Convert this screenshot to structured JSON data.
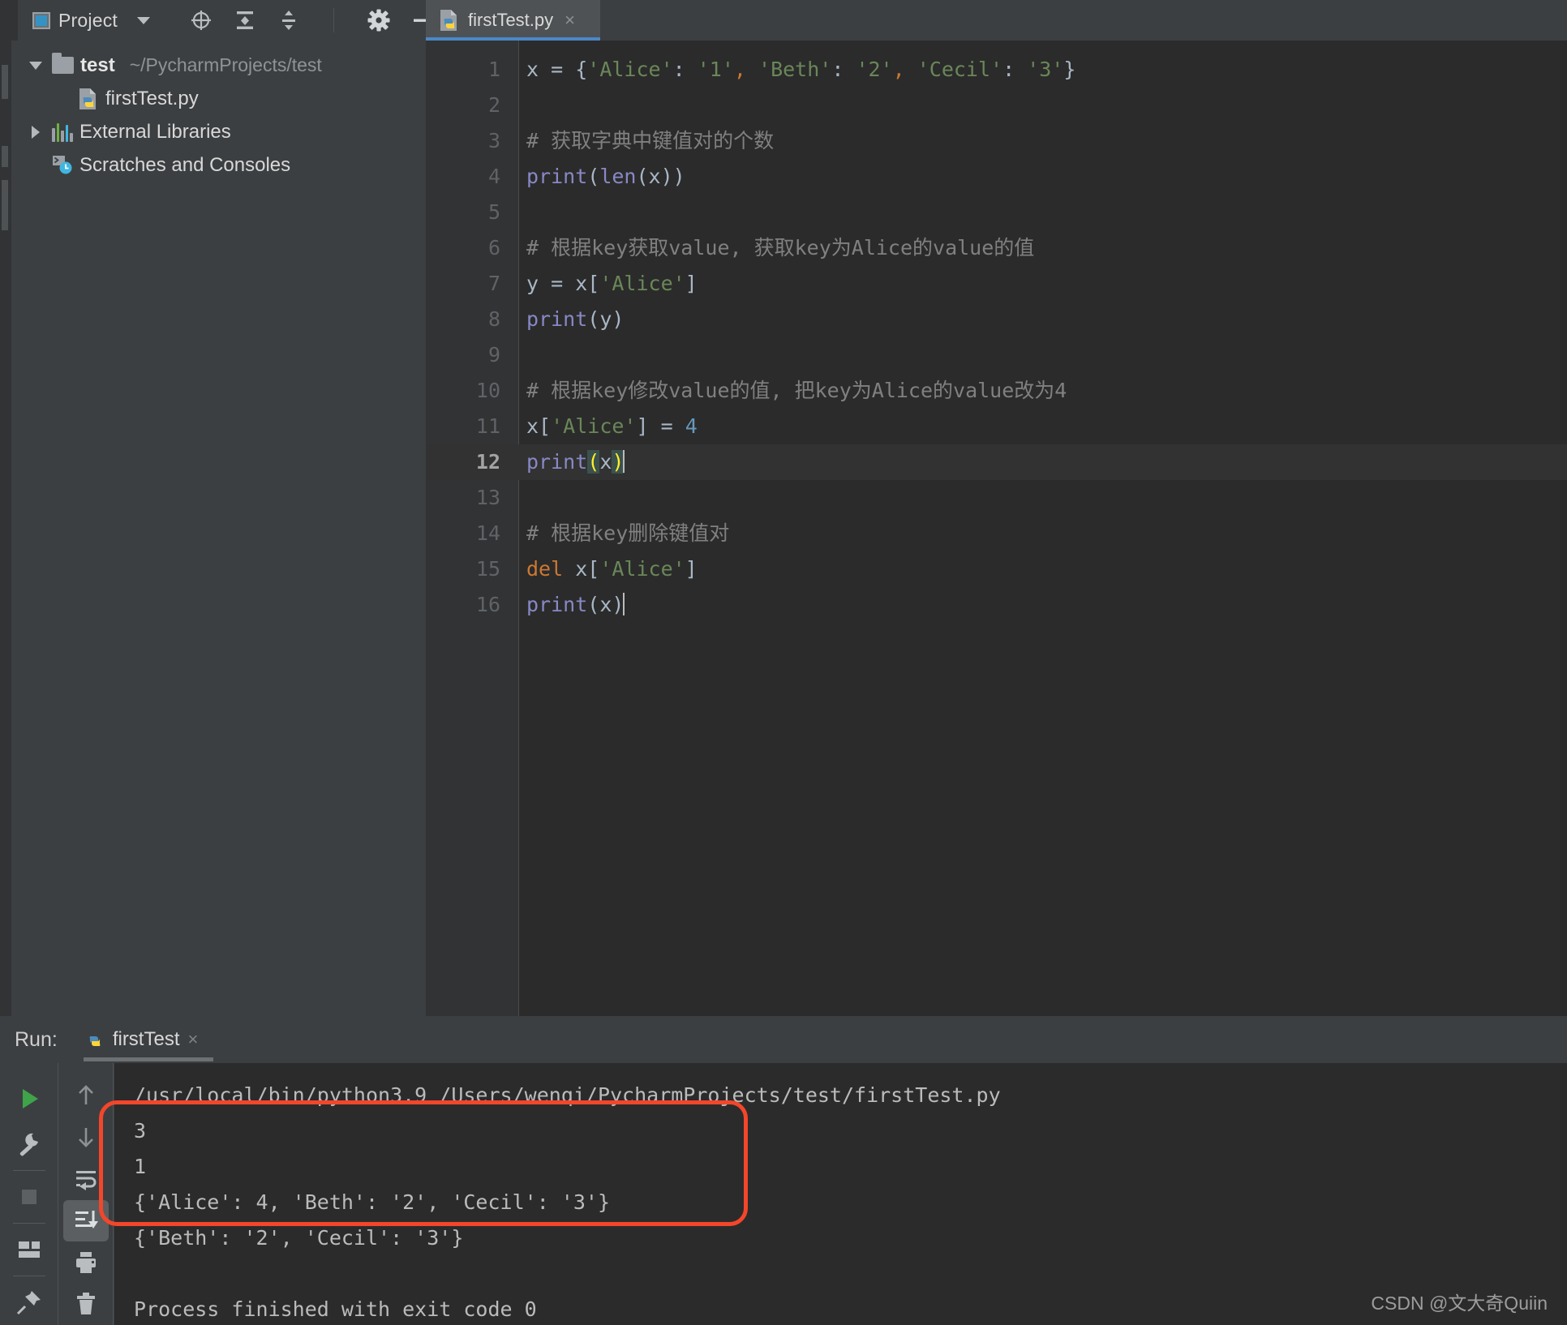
{
  "toolbar": {
    "project_label": "Project",
    "icons": [
      {
        "name": "locate-icon",
        "glyph": "target"
      },
      {
        "name": "expand-all-icon",
        "glyph": "expand"
      },
      {
        "name": "collapse-all-icon",
        "glyph": "collapse"
      },
      {
        "name": "settings-gear-icon",
        "glyph": "gear"
      },
      {
        "name": "hide-panel-icon",
        "glyph": "minus"
      }
    ]
  },
  "tab": {
    "label": "firstTest.py",
    "close": "×",
    "icon": "python-file-icon"
  },
  "tree": {
    "items": [
      {
        "name": "test",
        "path": "~/PycharmProjects/test",
        "icon": "folder-icon",
        "chevron": "down",
        "bold": true
      },
      {
        "name": "firstTest.py",
        "path": "",
        "icon": "python-file-icon",
        "chevron": "none",
        "bold": false
      },
      {
        "name": "External Libraries",
        "path": "",
        "icon": "libraries-icon",
        "chevron": "right",
        "bold": false
      },
      {
        "name": "Scratches and Consoles",
        "path": "",
        "icon": "scratches-icon",
        "chevron": "none",
        "bold": false
      }
    ]
  },
  "editor": {
    "current_line": 12,
    "lines": [
      {
        "n": "1",
        "tokens": [
          {
            "t": "x = {",
            "c": "plain"
          },
          {
            "t": "'Alice'",
            "c": "str"
          },
          {
            "t": ": ",
            "c": "plain"
          },
          {
            "t": "'1'",
            "c": "str"
          },
          {
            "t": ",",
            "c": "comma"
          },
          {
            "t": " ",
            "c": "plain"
          },
          {
            "t": "'Beth'",
            "c": "str"
          },
          {
            "t": ": ",
            "c": "plain"
          },
          {
            "t": "'2'",
            "c": "str"
          },
          {
            "t": ",",
            "c": "comma"
          },
          {
            "t": " ",
            "c": "plain"
          },
          {
            "t": "'Cecil'",
            "c": "str"
          },
          {
            "t": ": ",
            "c": "plain"
          },
          {
            "t": "'3'",
            "c": "str"
          },
          {
            "t": "}",
            "c": "plain"
          }
        ]
      },
      {
        "n": "2",
        "tokens": []
      },
      {
        "n": "3",
        "tokens": [
          {
            "t": "# 获取字典中键值对的个数",
            "c": "comment"
          }
        ]
      },
      {
        "n": "4",
        "tokens": [
          {
            "t": "print",
            "c": "func"
          },
          {
            "t": "(",
            "c": "plain"
          },
          {
            "t": "len",
            "c": "func"
          },
          {
            "t": "(x))",
            "c": "plain"
          }
        ]
      },
      {
        "n": "5",
        "tokens": []
      },
      {
        "n": "6",
        "tokens": [
          {
            "t": "# 根据key获取value, 获取key为Alice的value的值",
            "c": "comment"
          }
        ]
      },
      {
        "n": "7",
        "tokens": [
          {
            "t": "y = x[",
            "c": "plain"
          },
          {
            "t": "'Alice'",
            "c": "str"
          },
          {
            "t": "]",
            "c": "plain"
          }
        ]
      },
      {
        "n": "8",
        "tokens": [
          {
            "t": "print",
            "c": "func"
          },
          {
            "t": "(y)",
            "c": "plain"
          }
        ]
      },
      {
        "n": "9",
        "tokens": []
      },
      {
        "n": "10",
        "tokens": [
          {
            "t": "# 根据key修改value的值, 把key为Alice的value改为4",
            "c": "comment"
          }
        ]
      },
      {
        "n": "11",
        "tokens": [
          {
            "t": "x[",
            "c": "plain"
          },
          {
            "t": "'Alice'",
            "c": "str"
          },
          {
            "t": "] = ",
            "c": "plain"
          },
          {
            "t": "4",
            "c": "num"
          }
        ]
      },
      {
        "n": "12",
        "tokens": [
          {
            "t": "print",
            "c": "func"
          },
          {
            "t": "(",
            "c": "brk"
          },
          {
            "t": "x",
            "c": "plain"
          },
          {
            "t": ")",
            "c": "brk"
          }
        ]
      },
      {
        "n": "13",
        "tokens": []
      },
      {
        "n": "14",
        "tokens": [
          {
            "t": "# 根据key删除键值对",
            "c": "comment"
          }
        ]
      },
      {
        "n": "15",
        "tokens": [
          {
            "t": "del",
            "c": "kw"
          },
          {
            "t": " x[",
            "c": "plain"
          },
          {
            "t": "'Alice'",
            "c": "str"
          },
          {
            "t": "]",
            "c": "plain"
          }
        ]
      },
      {
        "n": "16",
        "tokens": [
          {
            "t": "print",
            "c": "func"
          },
          {
            "t": "(x)",
            "c": "plain"
          }
        ]
      }
    ]
  },
  "run": {
    "title": "Run:",
    "tab_label": "firstTest",
    "tab_close": "×",
    "rail_left": [
      {
        "name": "rerun-button",
        "glyph": "play"
      },
      {
        "name": "debug-settings-button",
        "glyph": "wrench"
      },
      {
        "name": "stop-button",
        "glyph": "stop"
      },
      {
        "name": "layout-button",
        "glyph": "layout"
      },
      {
        "name": "pin-tab-button",
        "glyph": "pin"
      }
    ],
    "rail_right": [
      {
        "name": "scroll-up-button",
        "glyph": "arrow-up"
      },
      {
        "name": "scroll-down-button",
        "glyph": "arrow-down"
      },
      {
        "name": "soft-wrap-button",
        "glyph": "wrap"
      },
      {
        "name": "scroll-to-end-button",
        "glyph": "scroll-end",
        "selected": true
      },
      {
        "name": "print-button",
        "glyph": "printer"
      },
      {
        "name": "clear-all-button",
        "glyph": "trash"
      }
    ],
    "console": {
      "command": "/usr/local/bin/python3.9 /Users/wenqi/PycharmProjects/test/firstTest.py",
      "output": [
        "3",
        "1",
        "{'Alice': 4, 'Beth': '2', 'Cecil': '3'}",
        "{'Beth': '2', 'Cecil': '3'}"
      ],
      "finished": "Process finished with exit code 0"
    },
    "highlight_color": "#f3462a"
  },
  "watermark": "CSDN @文大奇Quiin"
}
